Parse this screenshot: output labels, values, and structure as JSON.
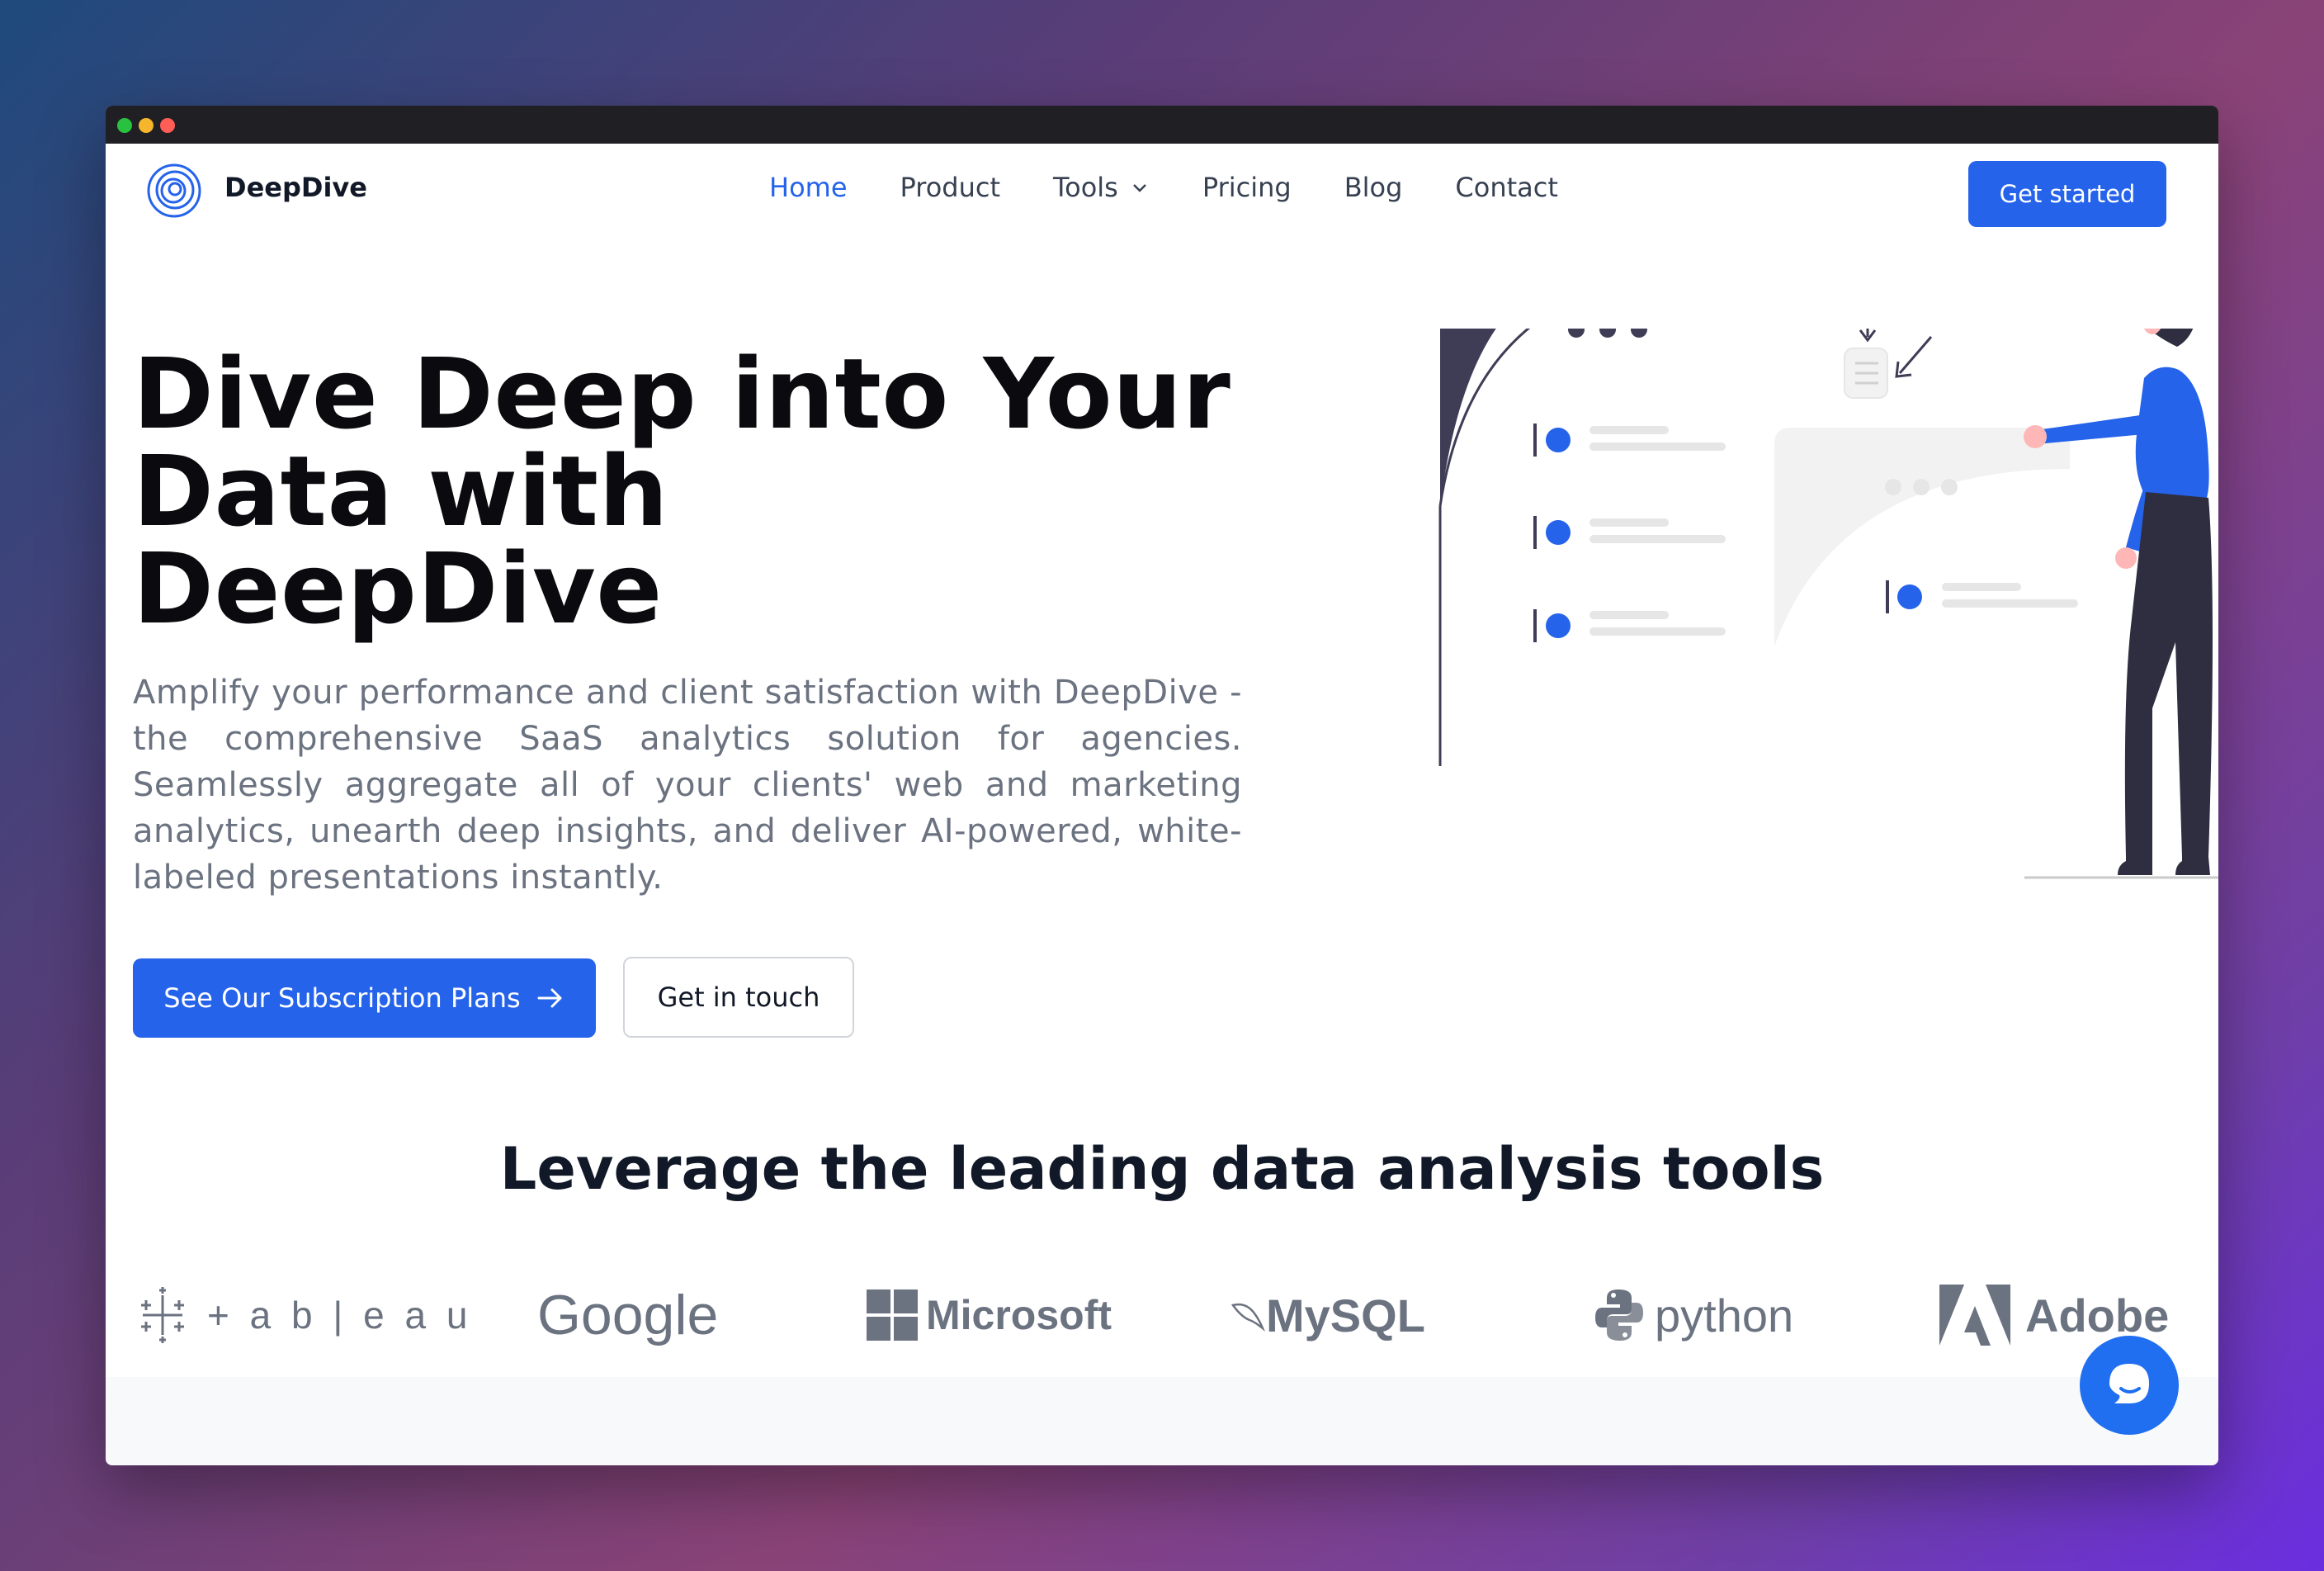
{
  "nav": {
    "brand": "DeepDive",
    "items": [
      {
        "label": "Home",
        "active": true
      },
      {
        "label": "Product"
      },
      {
        "label": "Tools",
        "has_dropdown": true
      },
      {
        "label": "Pricing"
      },
      {
        "label": "Blog"
      },
      {
        "label": "Contact"
      }
    ],
    "cta_label": "Get started"
  },
  "hero": {
    "title_line1": "Dive Deep into Your",
    "title_line2": "Data with",
    "title_line3": "DeepDive",
    "description": "Amplify your performance and client satisfaction with DeepDive - the comprehensive SaaS analytics solution for agencies. Seamlessly aggregate all of your clients' web and marketing analytics, unearth deep insights, and deliver AI-powered, white-labeled presentations instantly.",
    "primary_button": "See Our Subscription Plans",
    "secondary_button": "Get in touch"
  },
  "tools_section": {
    "title": "Leverage the leading data analysis tools",
    "logos": [
      {
        "name": "tableau",
        "text": "+ a b | e a u",
        "icon": "tableau-icon"
      },
      {
        "name": "google",
        "text": "Google",
        "icon": ""
      },
      {
        "name": "microsoft",
        "text": "Microsoft",
        "icon": "microsoft-icon"
      },
      {
        "name": "mysql",
        "text": "MySQL",
        "icon": "mysql-dolphin-icon"
      },
      {
        "name": "python",
        "text": "python",
        "icon": "python-icon"
      },
      {
        "name": "adobe",
        "text": "Adobe",
        "icon": "adobe-icon"
      }
    ]
  },
  "colors": {
    "accent": "#2563eb",
    "dark_text": "#111827",
    "muted_text": "#6b7280",
    "illustration_pink": "#ff6584",
    "illustration_dark": "#3f3d56"
  }
}
